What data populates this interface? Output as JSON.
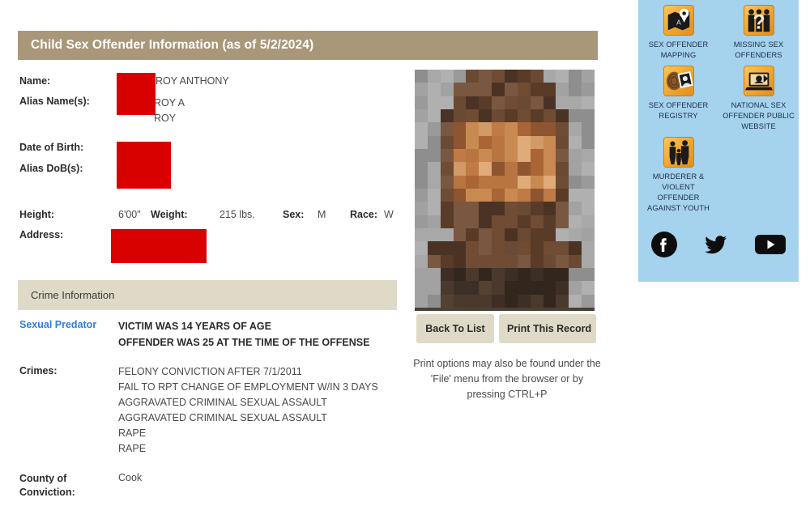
{
  "record": {
    "title": "Child Sex Offender Information (as of 5/2/2024)",
    "labels": {
      "name": "Name:",
      "alias_names": "Alias Name(s):",
      "date_of_birth": "Date of Birth:",
      "alias_dob": "Alias DoB(s):",
      "address": "Address:",
      "crimes": "Crimes:",
      "county_of_conviction_line1": "County of",
      "county_of_conviction_line2": "Conviction:"
    },
    "name_value": "ROY ANTHONY",
    "alias_names": [
      "ROY A",
      "ROY"
    ],
    "date_of_birth": "",
    "alias_dob": "",
    "address": "",
    "physical": {
      "height_key": "Height:",
      "height_val": "6'00\"",
      "weight_key": "Weight:",
      "weight_val": "215 lbs.",
      "sex_key": "Sex:",
      "sex_val": "M",
      "race_key": "Race:",
      "race_val": "W"
    },
    "crime_section_title": "Crime Information",
    "predator_flag": "Sexual Predator",
    "predator_detail": [
      "VICTIM WAS 14 YEARS OF AGE",
      "OFFENDER WAS 25 AT THE TIME OF THE OFFENSE"
    ],
    "crimes": [
      "FELONY CONVICTION AFTER 7/1/2011",
      "FAIL TO RPT CHANGE OF EMPLOYMENT W/IN 3 DAYS",
      "AGGRAVATED CRIMINAL SEXUAL ASSAULT",
      "AGGRAVATED CRIMINAL SEXUAL ASSAULT",
      "RAPE",
      "RAPE"
    ],
    "county_of_conviction": "Cook"
  },
  "photo": {
    "alt_name": "offender-photo",
    "state": "pixelated"
  },
  "actions": {
    "back_to_list": "Back To List",
    "print_record": "Print This Record",
    "print_hint": "Print options may also be found under the 'File' menu from the browser or by pressing CTRL+P"
  },
  "sidebar": {
    "quick_links": [
      {
        "icon": "map-pin-icon",
        "lines": [
          "SEX OFFENDER",
          "MAPPING"
        ]
      },
      {
        "icon": "missing-persons-icon",
        "lines": [
          "MISSING SEX",
          "OFFENDERS"
        ]
      },
      {
        "icon": "fingerprint-icon",
        "lines": [
          "SEX OFFENDER",
          "REGISTRY"
        ]
      },
      {
        "icon": "laptop-icon",
        "lines": [
          "NATIONAL SEX",
          "OFFENDER PUBLIC",
          "WEBSITE"
        ]
      },
      {
        "icon": "people-silhouette-icon",
        "lines": [
          "MURDERER &",
          "VIOLENT",
          "OFFENDER",
          "AGAINST YOUTH"
        ]
      }
    ],
    "social": [
      {
        "icon": "facebook-icon",
        "name": "Facebook"
      },
      {
        "icon": "twitter-icon",
        "name": "Twitter"
      },
      {
        "icon": "youtube-icon",
        "name": "YouTube"
      }
    ]
  },
  "colors": {
    "title_bar": "#a89879",
    "section_band": "#dedac7",
    "redaction": "#d90000",
    "link": "#2f7ed8",
    "sidebar_bg": "#a5d2ec",
    "icon_tile": "#f0a52e"
  }
}
